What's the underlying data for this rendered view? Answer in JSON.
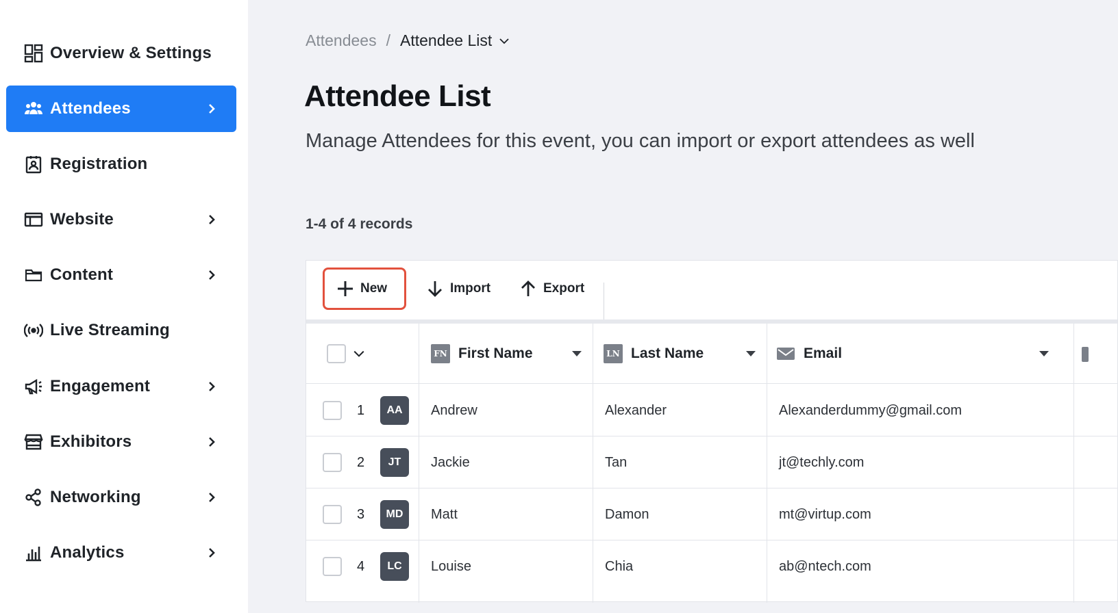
{
  "sidebar": {
    "items": [
      {
        "label": "Overview & Settings",
        "icon": "dashboard-icon",
        "chevron": false
      },
      {
        "label": "Attendees",
        "icon": "users-icon",
        "chevron": true,
        "active": true
      },
      {
        "label": "Registration",
        "icon": "badge-icon",
        "chevron": false
      },
      {
        "label": "Website",
        "icon": "browser-window-icon",
        "chevron": true
      },
      {
        "label": "Content",
        "icon": "folder-icon",
        "chevron": true
      },
      {
        "label": "Live Streaming",
        "icon": "broadcast-icon",
        "chevron": false
      },
      {
        "label": "Engagement",
        "icon": "megaphone-icon",
        "chevron": true
      },
      {
        "label": "Exhibitors",
        "icon": "storefront-icon",
        "chevron": true
      },
      {
        "label": "Networking",
        "icon": "share-nodes-icon",
        "chevron": true
      },
      {
        "label": "Analytics",
        "icon": "bar-chart-icon",
        "chevron": true
      }
    ],
    "accent": "#1f7cf5"
  },
  "breadcrumb": {
    "root": "Attendees",
    "separator": "/",
    "current": "Attendee List"
  },
  "page": {
    "title": "Attendee List",
    "description": "Manage Attendees for this event, you can import or export attendees as well",
    "record_count": "1-4 of 4 records"
  },
  "toolbar": {
    "new_label": "New",
    "import_label": "Import",
    "export_label": "Export"
  },
  "table": {
    "columns": [
      {
        "label": "First Name",
        "badge": "FN"
      },
      {
        "label": "Last Name",
        "badge": "LN"
      },
      {
        "label": "Email",
        "icon": "envelope-icon"
      }
    ],
    "rows": [
      {
        "num": "1",
        "initials": "AA",
        "first": "Andrew",
        "last": "Alexander",
        "email": "Alexanderdummy@gmail.com"
      },
      {
        "num": "2",
        "initials": "JT",
        "first": "Jackie",
        "last": "Tan",
        "email": "jt@techly.com"
      },
      {
        "num": "3",
        "initials": "MD",
        "first": "Matt",
        "last": "Damon",
        "email": "mt@virtup.com"
      },
      {
        "num": "4",
        "initials": "LC",
        "first": "Louise",
        "last": "Chia",
        "email": "ab@ntech.com"
      }
    ]
  }
}
